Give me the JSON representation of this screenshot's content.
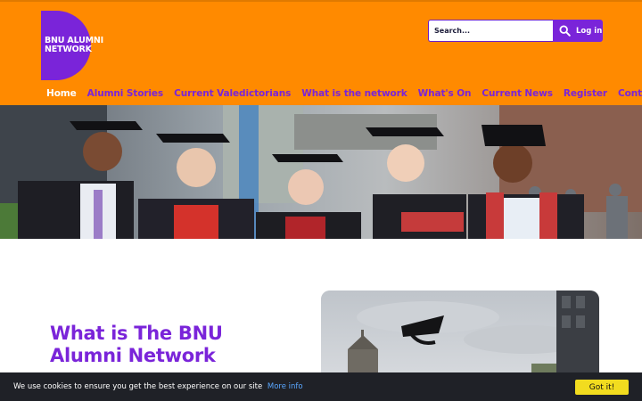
{
  "logo": {
    "line1": "BNU ALUMNI",
    "line2": "NETWORK"
  },
  "search": {
    "placeholder": "Search...",
    "login_label": "Log in"
  },
  "nav": {
    "items": [
      {
        "label": "Home",
        "active": true
      },
      {
        "label": "Alumni Stories",
        "active": false
      },
      {
        "label": "Current Valedictorians",
        "active": false
      },
      {
        "label": "What is the network",
        "active": false
      },
      {
        "label": "What's On",
        "active": false
      },
      {
        "label": "Current News",
        "active": false
      },
      {
        "label": "Register",
        "active": false
      },
      {
        "label": "Contact",
        "active": false
      }
    ]
  },
  "main": {
    "section_title": "What is The BNU Alumni Network"
  },
  "cookie": {
    "message": "We use cookies to ensure you get the best experience on our site",
    "link_label": "More info",
    "button_label": "Got it!"
  },
  "colors": {
    "header_bg": "#ff8a00",
    "brand_purple": "#7a24d9",
    "cookie_bar": "#1f2127",
    "cookie_button": "#f2dc1f",
    "link_blue": "#5aa7ff"
  }
}
